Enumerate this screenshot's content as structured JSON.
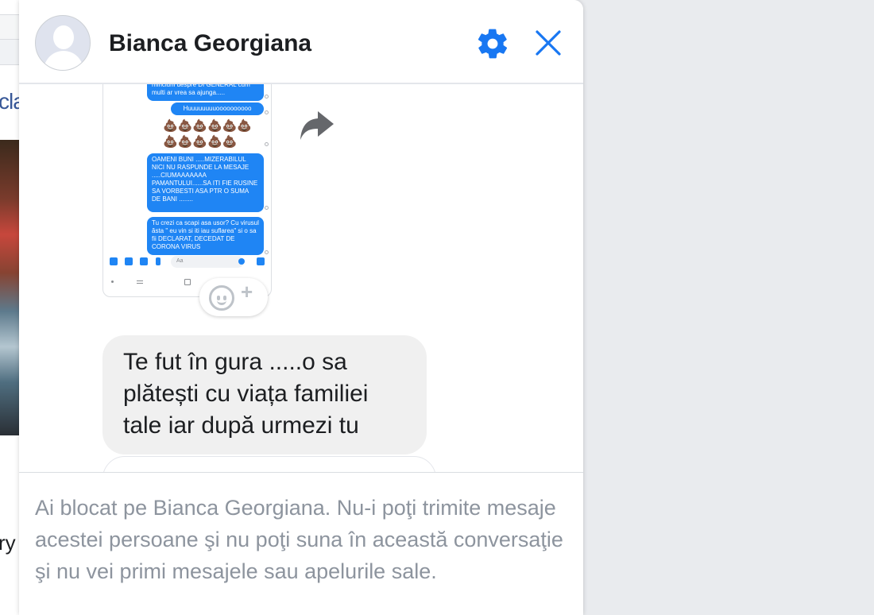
{
  "background": {
    "link_fragment": "cla",
    "text_fragment": "ry"
  },
  "header": {
    "contact_name": "Bianca Georgiana",
    "settings_icon": "gear-icon",
    "close_icon": "close-icon"
  },
  "screenshot": {
    "bubbles": [
      "minciuni despre DI GENERAL cum multi ar vrea sa ajunga.....",
      "Huuuuuuuuoooooooooo",
      "OAMENI BUNI .....MIZERABILUL NICI NU RASPUNDE LA MESAJE .....CIUMAAAAAAA PAMANTULUI......SA ITI FIE RUSINE SA VORBESTI ASA PTR O SUMA DE BANI ........",
      "Tu crezi ca scapi asa usor? Cu virusul ăsta \" eu vin si iti iau suflarea\" si o sa fii DECLARAT, DECEDAT DE CORONA VIRUS"
    ],
    "poop_row_1": "💩💩💩💩💩💩",
    "poop_row_2": "💩💩💩💩💩",
    "input_placeholder": "Aa"
  },
  "messages": {
    "received_text": "Te fut în gura .....o sa plătești cu viața familiei tale iar după urmezi tu"
  },
  "blocked_notice": "Ai blocat pe Bianca Georgiana. Nu-i poţi trimite mesaje acestei persoane şi nu poţi suna în această conversaţie şi nu vei primi mesajele sau apelurile sale.",
  "colors": {
    "accent": "#1877f2",
    "bubble_sent": "#1f85f4",
    "bubble_received": "#f0f0f0",
    "notice_text": "#8d949e"
  }
}
